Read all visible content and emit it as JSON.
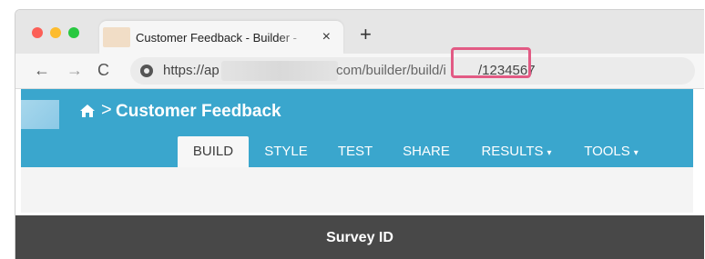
{
  "browser": {
    "tab_title": "Customer Feedback - Builder - ",
    "tab_close": "×",
    "new_tab": "+",
    "nav": {
      "back": "←",
      "forward": "→",
      "reload": "C"
    },
    "url_part1": "https://ap",
    "url_part2": "com/builder/build/i",
    "url_part3": "/1234567"
  },
  "app": {
    "breadcrumb_sep": ">",
    "title": "Customer Feedback",
    "tabs": [
      {
        "label": "BUILD",
        "active": true
      },
      {
        "label": "STYLE"
      },
      {
        "label": "TEST"
      },
      {
        "label": "SHARE"
      },
      {
        "label": "RESULTS",
        "dropdown": true
      },
      {
        "label": "TOOLS",
        "dropdown": true
      }
    ],
    "caret": "▾"
  },
  "banner": {
    "label": "Survey ID"
  },
  "colors": {
    "header": "#3aa6cd",
    "highlight": "#e25a84",
    "banner": "#484848"
  }
}
